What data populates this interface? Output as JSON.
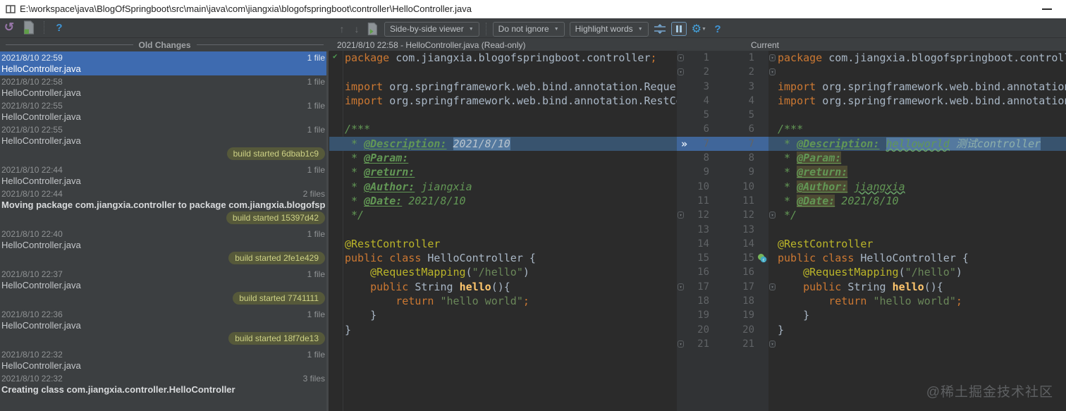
{
  "window": {
    "title": "E:\\workspace\\java\\BlogOfSpringboot\\src\\main\\java\\com\\jiangxia\\blogofspringboot\\controller\\HelloController.java",
    "minimize_tooltip": "Minimize"
  },
  "toolbar": {
    "undo_glyph": "↺",
    "help_glyph": "?",
    "up_glyph": "↑",
    "down_glyph": "↓",
    "viewer_dropdown": "Side-by-side viewer",
    "ignore_dropdown": "Do not ignore",
    "highlight_dropdown": "Highlight words",
    "caret_glyph": "▼",
    "gear_glyph": "⚙"
  },
  "history": {
    "header": "Old Changes",
    "items": [
      {
        "type": "entry",
        "date": "2021/8/10 22:59",
        "label": "HelloController.java",
        "files": "1 file",
        "selected": true
      },
      {
        "type": "entry",
        "date": "2021/8/10 22:58",
        "label": "HelloController.java",
        "files": "1 file"
      },
      {
        "type": "entry",
        "date": "2021/8/10 22:55",
        "label": "HelloController.java",
        "files": "1 file"
      },
      {
        "type": "entry",
        "date": "2021/8/10 22:55",
        "label": "HelloController.java",
        "files": "1 file"
      },
      {
        "type": "badge",
        "label": "build started 6dbab1c9"
      },
      {
        "type": "entry",
        "date": "2021/8/10 22:44",
        "label": "HelloController.java",
        "files": "1 file"
      },
      {
        "type": "entry",
        "date": "2021/8/10 22:44",
        "label": "Moving package com.jiangxia.controller to package com.jiangxia.blogofspringb...",
        "files": "2 files",
        "bold": true
      },
      {
        "type": "badge",
        "label": "build started 15397d42"
      },
      {
        "type": "entry",
        "date": "2021/8/10 22:40",
        "label": "HelloController.java",
        "files": "1 file"
      },
      {
        "type": "badge",
        "label": "build started 2fe1e429"
      },
      {
        "type": "entry",
        "date": "2021/8/10 22:37",
        "label": "HelloController.java",
        "files": "1 file"
      },
      {
        "type": "badge",
        "label": "build started 7741111"
      },
      {
        "type": "entry",
        "date": "2021/8/10 22:36",
        "label": "HelloController.java",
        "files": "1 file"
      },
      {
        "type": "badge",
        "label": "build started 18f7de13"
      },
      {
        "type": "entry",
        "date": "2021/8/10 22:32",
        "label": "HelloController.java",
        "files": "1 file"
      },
      {
        "type": "entry",
        "date": "2021/8/10 22:32",
        "label": "Creating class com.jiangxia.controller.HelloController",
        "files": "3 files",
        "bold": true
      }
    ]
  },
  "diff": {
    "left_title": "2021/8/10 22:58 - HelloController.java (Read-only)",
    "right_title": "Current",
    "check_glyph": "✔",
    "change_marker_glyph": "»",
    "gutter": {
      "count": 21,
      "changed_row": 7,
      "spring_icon_row": 15,
      "fold_rows": [
        1,
        2,
        12,
        17,
        21
      ]
    },
    "left_lines": [
      {
        "tokens": [
          [
            "kw",
            "package "
          ],
          [
            "pln",
            "com.jiangxia.blogofspringboot.controller"
          ],
          [
            "kw",
            ";"
          ]
        ]
      },
      {
        "tokens": []
      },
      {
        "tokens": [
          [
            "kw",
            "import "
          ],
          [
            "pln",
            "org.springframework.web.bind.annotation.RequestMapping"
          ],
          [
            "kw",
            ";"
          ]
        ]
      },
      {
        "tokens": [
          [
            "kw",
            "import "
          ],
          [
            "pln",
            "org.springframework.web.bind.annotation.RestController"
          ],
          [
            "kw",
            ";"
          ]
        ]
      },
      {
        "tokens": []
      },
      {
        "tokens": [
          [
            "cmt",
            "/***"
          ]
        ]
      },
      {
        "changed": true,
        "tokens": [
          [
            "cmt",
            " * "
          ],
          [
            "tag",
            "@Description:"
          ],
          [
            "cmt",
            " "
          ],
          [
            "val hl",
            "2021/8/10"
          ]
        ]
      },
      {
        "tokens": [
          [
            "cmt",
            " * "
          ],
          [
            "tag",
            "@Param:"
          ]
        ]
      },
      {
        "tokens": [
          [
            "cmt",
            " * "
          ],
          [
            "tag",
            "@return:"
          ]
        ]
      },
      {
        "tokens": [
          [
            "cmt",
            " * "
          ],
          [
            "tag",
            "@Author:"
          ],
          [
            "cmtv",
            " jiangxia"
          ]
        ]
      },
      {
        "tokens": [
          [
            "cmt",
            " * "
          ],
          [
            "tag",
            "@Date:"
          ],
          [
            "cmtv",
            " 2021/8/10"
          ]
        ]
      },
      {
        "tokens": [
          [
            "cmt",
            " */"
          ]
        ]
      },
      {
        "tokens": []
      },
      {
        "tokens": [
          [
            "ann",
            "@RestController"
          ]
        ]
      },
      {
        "tokens": [
          [
            "kw",
            "public class "
          ],
          [
            "pln",
            "HelloController {"
          ]
        ]
      },
      {
        "tokens": [
          [
            "pln",
            "    "
          ],
          [
            "ann",
            "@RequestMapping"
          ],
          [
            "pln",
            "("
          ],
          [
            "str",
            "\"/hello\""
          ],
          [
            "pln",
            ")"
          ]
        ]
      },
      {
        "tokens": [
          [
            "pln",
            "    "
          ],
          [
            "kw",
            "public "
          ],
          [
            "pln",
            "String "
          ],
          [
            "mth",
            "hello"
          ],
          [
            "pln",
            "(){"
          ]
        ]
      },
      {
        "tokens": [
          [
            "pln",
            "        "
          ],
          [
            "kw",
            "return "
          ],
          [
            "str",
            "\"hello world\""
          ],
          [
            "kw",
            ";"
          ]
        ]
      },
      {
        "tokens": [
          [
            "pln",
            "    }"
          ]
        ]
      },
      {
        "tokens": [
          [
            "pln",
            "}"
          ]
        ]
      },
      {
        "tokens": []
      }
    ],
    "right_lines": [
      {
        "tokens": [
          [
            "kw",
            "package "
          ],
          [
            "pln",
            "com.jiangxia.blogofspringboot.controller"
          ],
          [
            "kw",
            ";"
          ]
        ]
      },
      {
        "tokens": []
      },
      {
        "tokens": [
          [
            "kw",
            "import "
          ],
          [
            "pln",
            "org.springframework.web.bind.annotation.RequestMapping"
          ],
          [
            "kw",
            ";"
          ]
        ]
      },
      {
        "tokens": [
          [
            "kw",
            "import "
          ],
          [
            "pln",
            "org.springframework.web.bind.annotation.RestController"
          ],
          [
            "kw",
            ";"
          ]
        ]
      },
      {
        "tokens": []
      },
      {
        "tokens": [
          [
            "cmt",
            "/***"
          ]
        ]
      },
      {
        "changed": true,
        "tokens": [
          [
            "cmt",
            " * "
          ],
          [
            "tag",
            "@Description:"
          ],
          [
            "cmt",
            " "
          ],
          [
            "cmtv hl wavy",
            "helloworld"
          ],
          [
            "hl",
            " "
          ],
          [
            "tealv hl",
            "测试controller"
          ]
        ]
      },
      {
        "tokens": [
          [
            "cmt",
            " * "
          ],
          [
            "tag olive",
            "@Param:"
          ]
        ]
      },
      {
        "tokens": [
          [
            "cmt",
            " * "
          ],
          [
            "tag olive",
            "@return:"
          ]
        ]
      },
      {
        "tokens": [
          [
            "cmt",
            " * "
          ],
          [
            "tag olive",
            "@Author:"
          ],
          [
            "cmtv",
            " "
          ],
          [
            "cmtv wavy",
            "jiangxia"
          ]
        ]
      },
      {
        "tokens": [
          [
            "cmt",
            " * "
          ],
          [
            "tag olive",
            "@Date:"
          ],
          [
            "cmtv",
            " 2021/8/10"
          ]
        ]
      },
      {
        "tokens": [
          [
            "cmt",
            " */"
          ]
        ]
      },
      {
        "tokens": []
      },
      {
        "tokens": [
          [
            "ann",
            "@RestController"
          ]
        ]
      },
      {
        "tokens": [
          [
            "kw",
            "public class "
          ],
          [
            "pln",
            "HelloController {"
          ]
        ]
      },
      {
        "tokens": [
          [
            "pln",
            "    "
          ],
          [
            "ann",
            "@RequestMapping"
          ],
          [
            "pln",
            "("
          ],
          [
            "str",
            "\"/hello\""
          ],
          [
            "pln",
            ")"
          ]
        ]
      },
      {
        "tokens": [
          [
            "pln",
            "    "
          ],
          [
            "kw",
            "public "
          ],
          [
            "pln",
            "String "
          ],
          [
            "mth",
            "hello"
          ],
          [
            "pln",
            "(){"
          ]
        ]
      },
      {
        "tokens": [
          [
            "pln",
            "        "
          ],
          [
            "kw",
            "return "
          ],
          [
            "str",
            "\"hello world\""
          ],
          [
            "kw",
            ";"
          ]
        ]
      },
      {
        "tokens": [
          [
            "pln",
            "    }"
          ]
        ]
      },
      {
        "tokens": [
          [
            "pln",
            "}"
          ]
        ]
      },
      {
        "tokens": []
      }
    ]
  },
  "watermark": "@稀土掘金技术社区",
  "colors": {
    "selection_blue": "#3e6bb0",
    "changed_line": "#38536e",
    "changed_word": "#54799f",
    "gutter_changed": "#40669a",
    "badge_bg": "#56593a",
    "badge_text": "#cdd185",
    "editor_bg": "#2b2b2b",
    "panel_bg": "#3c3f41"
  }
}
